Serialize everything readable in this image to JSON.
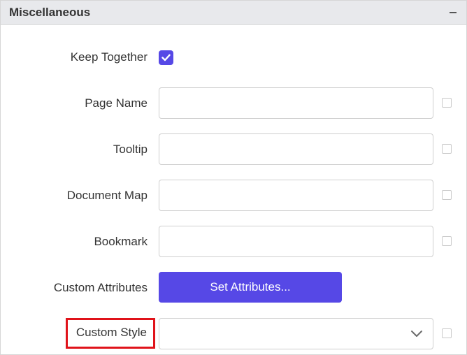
{
  "panel": {
    "title": "Miscellaneous",
    "collapse_icon": "minus-icon"
  },
  "rows": {
    "keep_together": {
      "label": "Keep Together",
      "checked": true
    },
    "page_name": {
      "label": "Page Name",
      "value": ""
    },
    "tooltip": {
      "label": "Tooltip",
      "value": ""
    },
    "document_map": {
      "label": "Document Map",
      "value": ""
    },
    "bookmark": {
      "label": "Bookmark",
      "value": ""
    },
    "custom_attributes": {
      "label": "Custom Attributes",
      "button_label": "Set Attributes..."
    },
    "custom_style": {
      "label": "Custom Style",
      "selected": ""
    }
  },
  "colors": {
    "accent": "#5648e6",
    "highlight_border": "#e0131a",
    "header_bg": "#e8e9ec"
  }
}
